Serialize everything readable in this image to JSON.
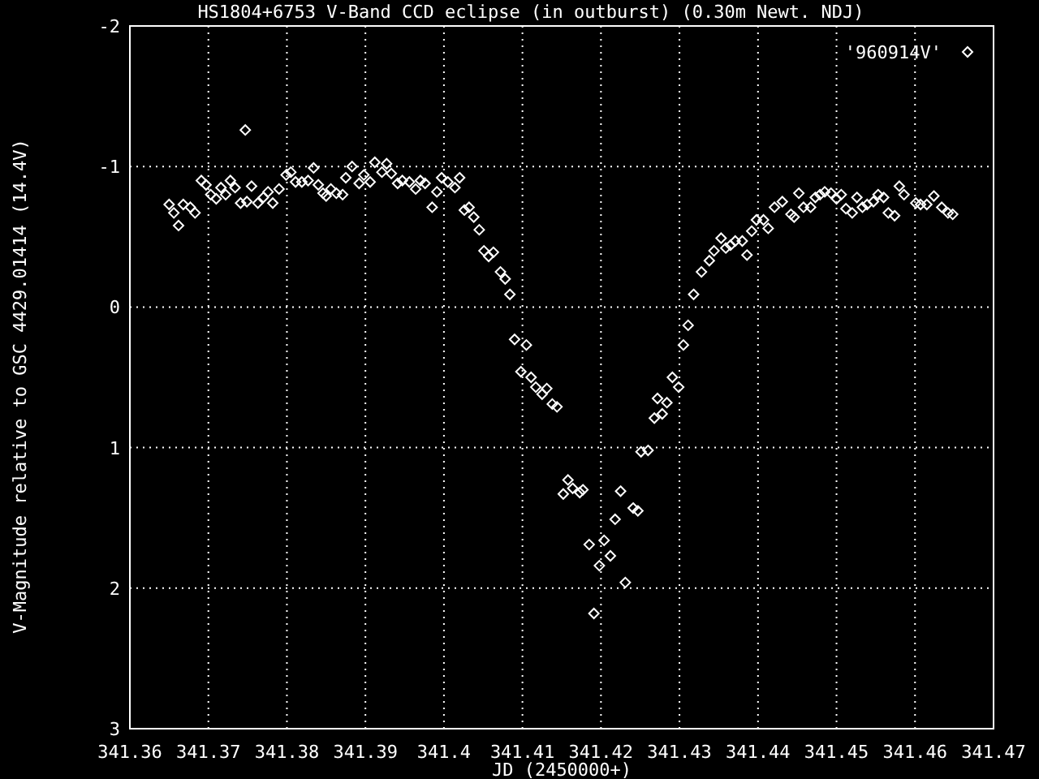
{
  "plot": {
    "chart_data": {
      "type": "scatter",
      "title": "HS1804+6753 V-Band CCD eclipse (in outburst) (0.30m Newt. NDJ)",
      "xlabel": "JD (2450000+)",
      "ylabel": "V-Magnitude relative to GSC 4429.01414 (14.4V)",
      "xlim": [
        341.36,
        341.47
      ],
      "ylim": [
        3,
        -2
      ],
      "xticks": [
        341.36,
        341.37,
        341.38,
        341.39,
        341.4,
        341.41,
        341.42,
        341.43,
        341.44,
        341.45,
        341.46,
        341.47
      ],
      "yticks": [
        -2,
        -1,
        0,
        1,
        2,
        3
      ],
      "grid": true,
      "series": [
        {
          "name": "'960914V'",
          "color": "#ffffff",
          "x": [
            341.365,
            341.3656,
            341.3662,
            341.3668,
            341.3677,
            341.3683,
            341.3691,
            341.3697,
            341.3703,
            341.371,
            341.3716,
            341.3722,
            341.3728,
            341.3734,
            341.3741,
            341.3747,
            341.3749,
            341.3755,
            341.3763,
            341.377,
            341.3776,
            341.3782,
            341.379,
            341.3799,
            341.3805,
            341.3811,
            341.3819,
            341.3827,
            341.3834,
            341.384,
            341.3846,
            341.385,
            341.3856,
            341.3863,
            341.3871,
            341.3875,
            341.3883,
            341.3892,
            341.3898,
            341.3906,
            341.3912,
            341.3921,
            341.3927,
            341.3933,
            341.3941,
            341.3947,
            341.3956,
            341.3964,
            341.397,
            341.3976,
            341.3985,
            341.3991,
            341.3997,
            341.4005,
            341.4014,
            341.402,
            341.4026,
            341.4032,
            341.4038,
            341.4045,
            341.4051,
            341.4057,
            341.4063,
            341.4072,
            341.4078,
            341.4084,
            341.409,
            341.4098,
            341.4105,
            341.4111,
            341.4117,
            341.4125,
            341.4131,
            341.4138,
            341.4144,
            341.4152,
            341.4158,
            341.4164,
            341.4173,
            341.4177,
            341.4185,
            341.4191,
            341.4198,
            341.4204,
            341.4212,
            341.4218,
            341.4225,
            341.4231,
            341.4241,
            341.4247,
            341.4251,
            341.426,
            341.4268,
            341.4272,
            341.4278,
            341.4284,
            341.4291,
            341.4299,
            341.4305,
            341.4311,
            341.4318,
            341.4328,
            341.4338,
            341.4344,
            341.4353,
            341.4359,
            341.4365,
            341.4371,
            341.438,
            341.4386,
            341.4392,
            341.4398,
            341.4407,
            341.4413,
            341.4421,
            341.4431,
            341.4442,
            341.4446,
            341.4452,
            341.4458,
            341.4467,
            341.4473,
            341.4479,
            341.4485,
            341.4493,
            341.45,
            341.4506,
            341.4512,
            341.452,
            341.4526,
            341.4533,
            341.4539,
            341.4547,
            341.4553,
            341.456,
            341.4566,
            341.4574,
            341.458,
            341.4586,
            341.4601,
            341.4607,
            341.4615,
            341.4624,
            341.4634,
            341.4642,
            341.4648
          ],
          "values": [
            -0.73,
            -0.67,
            -0.58,
            -0.73,
            -0.71,
            -0.67,
            -0.9,
            -0.87,
            -0.8,
            -0.77,
            -0.85,
            -0.8,
            -0.9,
            -0.85,
            -0.74,
            -1.26,
            -0.75,
            -0.86,
            -0.74,
            -0.78,
            -0.82,
            -0.74,
            -0.84,
            -0.94,
            -0.96,
            -0.89,
            -0.89,
            -0.9,
            -0.99,
            -0.87,
            -0.81,
            -0.79,
            -0.84,
            -0.81,
            -0.8,
            -0.92,
            -1.0,
            -0.88,
            -0.94,
            -0.89,
            -1.03,
            -0.96,
            -1.02,
            -0.95,
            -0.88,
            -0.9,
            -0.89,
            -0.84,
            -0.9,
            -0.88,
            -0.71,
            -0.82,
            -0.92,
            -0.89,
            -0.85,
            -0.92,
            -0.69,
            -0.71,
            -0.64,
            -0.55,
            -0.4,
            -0.36,
            -0.39,
            -0.25,
            -0.2,
            -0.09,
            0.23,
            0.46,
            0.27,
            0.5,
            0.57,
            0.62,
            0.58,
            0.69,
            0.71,
            1.33,
            1.23,
            1.29,
            1.32,
            1.3,
            1.69,
            2.18,
            1.84,
            1.66,
            1.77,
            1.51,
            1.31,
            1.96,
            1.43,
            1.45,
            1.03,
            1.02,
            0.79,
            0.65,
            0.76,
            0.68,
            0.5,
            0.57,
            0.27,
            0.13,
            -0.09,
            -0.25,
            -0.33,
            -0.4,
            -0.49,
            -0.42,
            -0.44,
            -0.47,
            -0.47,
            -0.37,
            -0.54,
            -0.62,
            -0.62,
            -0.56,
            -0.71,
            -0.75,
            -0.66,
            -0.64,
            -0.81,
            -0.71,
            -0.71,
            -0.78,
            -0.8,
            -0.82,
            -0.81,
            -0.77,
            -0.8,
            -0.7,
            -0.67,
            -0.78,
            -0.71,
            -0.73,
            -0.75,
            -0.8,
            -0.78,
            -0.67,
            -0.65,
            -0.86,
            -0.8,
            -0.74,
            -0.73,
            -0.73,
            -0.79,
            -0.71,
            -0.67,
            -0.66
          ]
        }
      ]
    }
  }
}
